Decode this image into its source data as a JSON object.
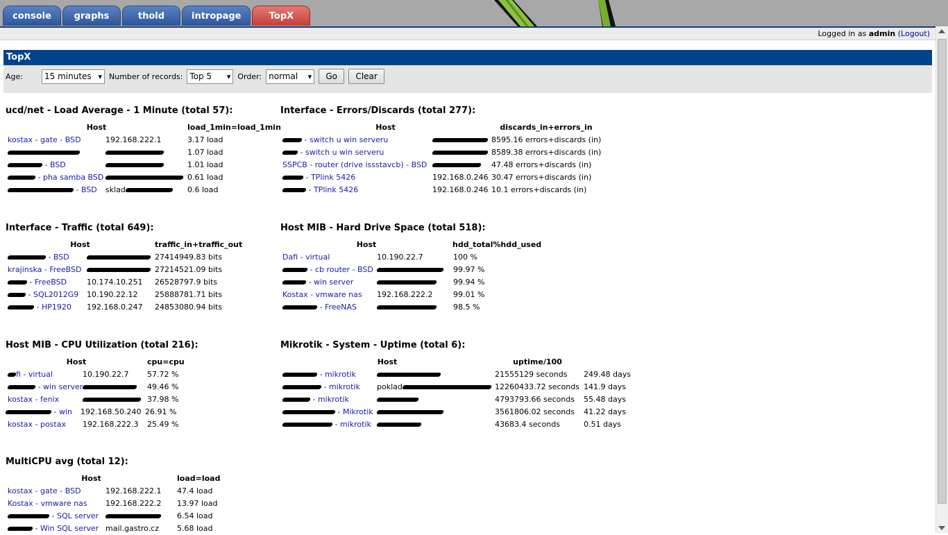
{
  "tabs": [
    "console",
    "graphs",
    "thold",
    "intropage",
    "TopX"
  ],
  "user": {
    "logged_in_as": "Logged in as",
    "username": "admin",
    "logout": "(Logout)"
  },
  "page_title": "TopX",
  "filter": {
    "age_label": "Age:",
    "age_value": "15 minutes",
    "records_label": "Number of records:",
    "records_value": "Top 5",
    "order_label": "Order:",
    "order_value": "normal",
    "go": "Go",
    "clear": "Clear"
  },
  "sections": {
    "load": {
      "title": "ucd/net - Load Average - 1 Minute (total 57):",
      "col_host": "Host",
      "col_value": "load_1min=load_1min",
      "rows": [
        {
          "host": "kostax - gate - BSD",
          "ip": "192.168.222.1",
          "value": "3.17 load"
        },
        {
          "host": "",
          "ip": "",
          "value": "1.07 load"
        },
        {
          "host": " - BSD",
          "ip": "",
          "value": "1.01 load"
        },
        {
          "host": " - pha samba BSD",
          "ip": "",
          "value": "0.61 load"
        },
        {
          "host": " - BSD",
          "ip": "sklad",
          "value": "0.6 load"
        }
      ]
    },
    "errors": {
      "title": "Interface - Errors/Discards (total 277):",
      "col_host": "Host",
      "col_value": "discards_in+errors_in",
      "rows": [
        {
          "host": " - switch u win serveru",
          "ip": "",
          "value": "8595.16 errors+discards (in)"
        },
        {
          "host": " - switch u win serveru",
          "ip": "",
          "value": "8589.38 errors+discards (in)"
        },
        {
          "host": "SSPCB - router (drive issstavcb) - BSD",
          "ip": "",
          "value": "47.48 errors+discards (in)"
        },
        {
          "host": " - TPlink 5426",
          "ip": "192.168.0.246",
          "value": "30.47 errors+discards (in)"
        },
        {
          "host": " - TPlink 5426",
          "ip": "192.168.0.246",
          "value": "10.1 errors+discards (in)"
        }
      ]
    },
    "traffic": {
      "title": "Interface - Traffic (total 649):",
      "col_host": "Host",
      "col_value": "traffic_in+traffic_out",
      "rows": [
        {
          "host": " - BSD",
          "ip": "",
          "value": "27414949.83 bits"
        },
        {
          "host": "krajinska - FreeBSD",
          "ip": "",
          "value": "27214521.09 bits"
        },
        {
          "host": " - FreeBSD",
          "ip": "10.174.10.251",
          "value": "26528797.9 bits"
        },
        {
          "host": " - SQL2012G9",
          "ip": "10.190.22.12",
          "value": "25888781.71 bits"
        },
        {
          "host": " - HP1920",
          "ip": "192.168.0.247",
          "value": "24853080.94 bits"
        }
      ]
    },
    "hdd": {
      "title": "Host MIB - Hard Drive Space (total 518):",
      "col_host": "Host",
      "col_value": "hdd_total%hdd_used",
      "rows": [
        {
          "host": "Dafi - virtual",
          "ip": "10.190.22.7",
          "value": "100 %"
        },
        {
          "host": " - cb router - BSD",
          "ip": "",
          "value": "99.97 %"
        },
        {
          "host": " - win server",
          "ip": "",
          "value": "99.94 %"
        },
        {
          "host": "Kostax - vmware nas",
          "ip": "192.168.222.2",
          "value": "99.01 %"
        },
        {
          "host": " - FreeNAS",
          "ip": "",
          "value": "98.5 %"
        }
      ]
    },
    "cpu": {
      "title": "Host MIB - CPU Utilization (total 216):",
      "col_host": "Host",
      "col_value": "cpu=cpu",
      "rows": [
        {
          "host": "fi - virtual",
          "ip": "10.190.22.7",
          "value": "57.72 %"
        },
        {
          "host": " - win server",
          "ip": "",
          "value": "49.46 %"
        },
        {
          "host": "kostax - fenix",
          "ip": "",
          "value": "37.98 %"
        },
        {
          "host": " - win",
          "ip": "192.168.50.240",
          "value": "26.91 %"
        },
        {
          "host": "kostax - postax",
          "ip": "192.168.222.3",
          "value": "25.49 %"
        }
      ]
    },
    "uptime": {
      "title": "Mikrotik - System - Uptime (total 6):",
      "col_host": "Host",
      "col_value": "uptime/100",
      "rows": [
        {
          "host": " - mikrotik",
          "ip": "",
          "value": "21555129 seconds",
          "days": "249.48 days"
        },
        {
          "host": " - mikrotik",
          "ip": "poklad",
          "value": "12260433.72 seconds",
          "days": "141.9 days"
        },
        {
          "host": " - mikrotik",
          "ip": "",
          "value": "4793793.66 seconds",
          "days": "55.48 days"
        },
        {
          "host": " - Mikrotik",
          "ip": "",
          "value": "3561806.02 seconds",
          "days": "41.22 days"
        },
        {
          "host": " - mikrotik",
          "ip": "",
          "value": "43683.4 seconds",
          "days": "0.51 days"
        }
      ]
    },
    "multicpu": {
      "title": "MultiCPU avg (total 12):",
      "col_host": "Host",
      "col_value": "load=load",
      "rows": [
        {
          "host": "kostax - gate - BSD",
          "ip": "192.168.222.1",
          "value": "47.4 load"
        },
        {
          "host": "Kostax - vmware nas",
          "ip": "192.168.222.2",
          "value": "13.97 load"
        },
        {
          "host": " - SQL server",
          "ip": "",
          "value": "6.54 load"
        },
        {
          "host": " - Win SQL server",
          "ip": "mail.gastro.cz",
          "value": "5.68 load"
        }
      ]
    }
  }
}
